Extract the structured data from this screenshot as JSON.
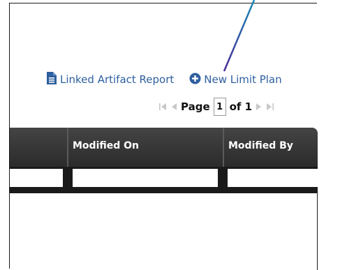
{
  "toolbar": {
    "report_label": "Linked Artifact Report",
    "new_plan_label": "New Limit Plan"
  },
  "pager": {
    "page_word": "Page",
    "current_page": "1",
    "of_label": "of 1"
  },
  "grid": {
    "columns": [
      {
        "label": ""
      },
      {
        "label": "Modified On"
      },
      {
        "label": "Modified By"
      }
    ]
  },
  "colors": {
    "link": "#2e5f9e",
    "header_bg": "#333333",
    "annotation_line": "#3a3a9a"
  },
  "icons": {
    "report": "document-icon",
    "new_plan": "plus-circle-icon",
    "first": "first-page-icon",
    "prev": "prev-page-icon",
    "next": "next-page-icon",
    "last": "last-page-icon"
  }
}
